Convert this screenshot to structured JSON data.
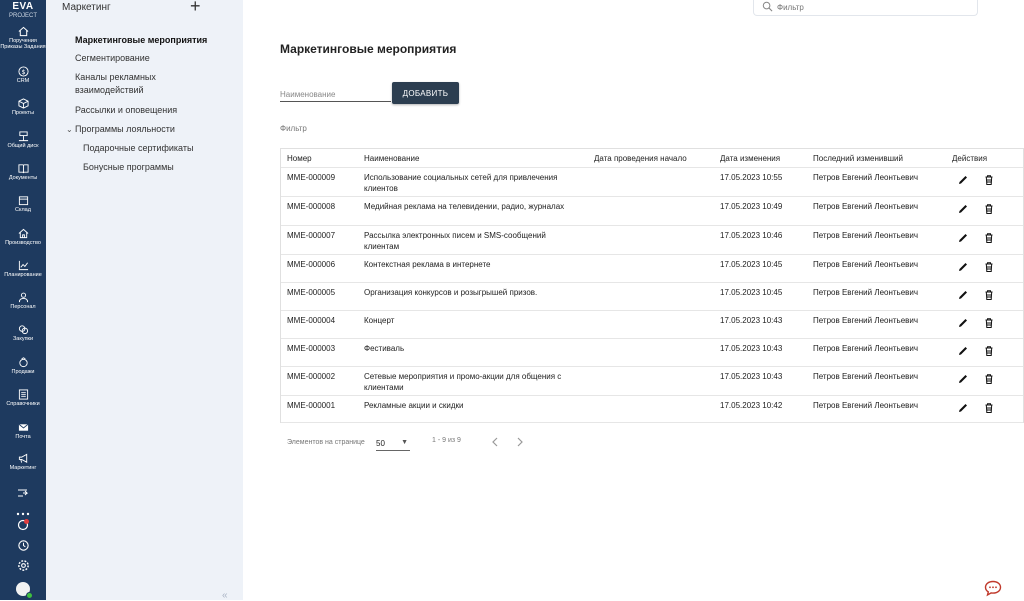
{
  "app": {
    "name_line1": "EVA",
    "name_line2": "PROJECT"
  },
  "rail": [
    {
      "label": "Поручения Приказы Задания",
      "icon": "home-icon"
    },
    {
      "label": "CRM",
      "icon": "dollar-icon"
    },
    {
      "label": "Проекты",
      "icon": "cube-icon"
    },
    {
      "label": "Общий диск",
      "icon": "network-icon"
    },
    {
      "label": "Документы",
      "icon": "book-icon"
    },
    {
      "label": "Склад",
      "icon": "box-icon"
    },
    {
      "label": "Производство",
      "icon": "factory-icon"
    },
    {
      "label": "Планирование",
      "icon": "chart-icon"
    },
    {
      "label": "Персонал",
      "icon": "person-icon"
    },
    {
      "label": "Закупки",
      "icon": "coins-icon"
    },
    {
      "label": "Продажи",
      "icon": "sales-icon"
    },
    {
      "label": "Справочники",
      "icon": "list-icon"
    },
    {
      "label": "Почта",
      "icon": "mail-icon"
    },
    {
      "label": "Маркетинг",
      "icon": "megaphone-icon"
    }
  ],
  "sidenav": {
    "title": "Маркетинг",
    "items": [
      {
        "label": "Маркетинговые мероприятия"
      },
      {
        "label": "Сегментирование"
      },
      {
        "label": "Каналы рекламных взаимодействий"
      },
      {
        "label": "Рассылки и оповещения"
      },
      {
        "label": "Программы лояльности"
      },
      {
        "label": "Подарочные сертификаты"
      },
      {
        "label": "Бонусные программы"
      }
    ]
  },
  "search": {
    "placeholder": "Фильтр"
  },
  "page": {
    "title": "Маркетинговые мероприятия",
    "name_placeholder": "Наименование",
    "add_label": "ДОБАВИТЬ",
    "filter_label": "Фильтр"
  },
  "table": {
    "headers": [
      "Номер",
      "Наименование",
      "Дата проведения начало",
      "Дата изменения",
      "Последний изменивший",
      "Действия"
    ],
    "rows": [
      {
        "num": "MME-000009",
        "name": "Использование социальных сетей для привлечения клиентов",
        "date": "17.05.2023 10:55",
        "user": "Петров Евгений Леонтьевич"
      },
      {
        "num": "MME-000008",
        "name": "Медийная реклама на телевидении, радио, журналах",
        "date": "17.05.2023 10:49",
        "user": "Петров Евгений Леонтьевич"
      },
      {
        "num": "MME-000007",
        "name": "Рассылка электронных писем и SMS-сообщений клиентам",
        "date": "17.05.2023 10:46",
        "user": "Петров Евгений Леонтьевич"
      },
      {
        "num": "MME-000006",
        "name": "Контекстная реклама в интернете",
        "date": "17.05.2023 10:45",
        "user": "Петров Евгений Леонтьевич"
      },
      {
        "num": "MME-000005",
        "name": "Организация конкурсов и розыгрышей призов.",
        "date": "17.05.2023 10:45",
        "user": "Петров Евгений Леонтьевич"
      },
      {
        "num": "MME-000004",
        "name": "Концерт",
        "date": "17.05.2023 10:43",
        "user": "Петров Евгений Леонтьевич"
      },
      {
        "num": "MME-000003",
        "name": "Фестиваль",
        "date": "17.05.2023 10:43",
        "user": "Петров Евгений Леонтьевич"
      },
      {
        "num": "MME-000002",
        "name": "Сетевые мероприятия и промо-акции для общения с клиентами",
        "date": "17.05.2023 10:43",
        "user": "Петров Евгений Леонтьевич"
      },
      {
        "num": "MME-000001",
        "name": "Рекламные акции и скидки",
        "date": "17.05.2023 10:42",
        "user": "Петров Евгений Леонтьевич"
      }
    ]
  },
  "pager": {
    "per_page_label": "Элементов на странице",
    "per_page_value": "50",
    "range": "1 - 9 из 9"
  },
  "colors": {
    "rail": "#1e3a5f",
    "sidenav": "#eef2f8",
    "button": "#2c3e50"
  }
}
